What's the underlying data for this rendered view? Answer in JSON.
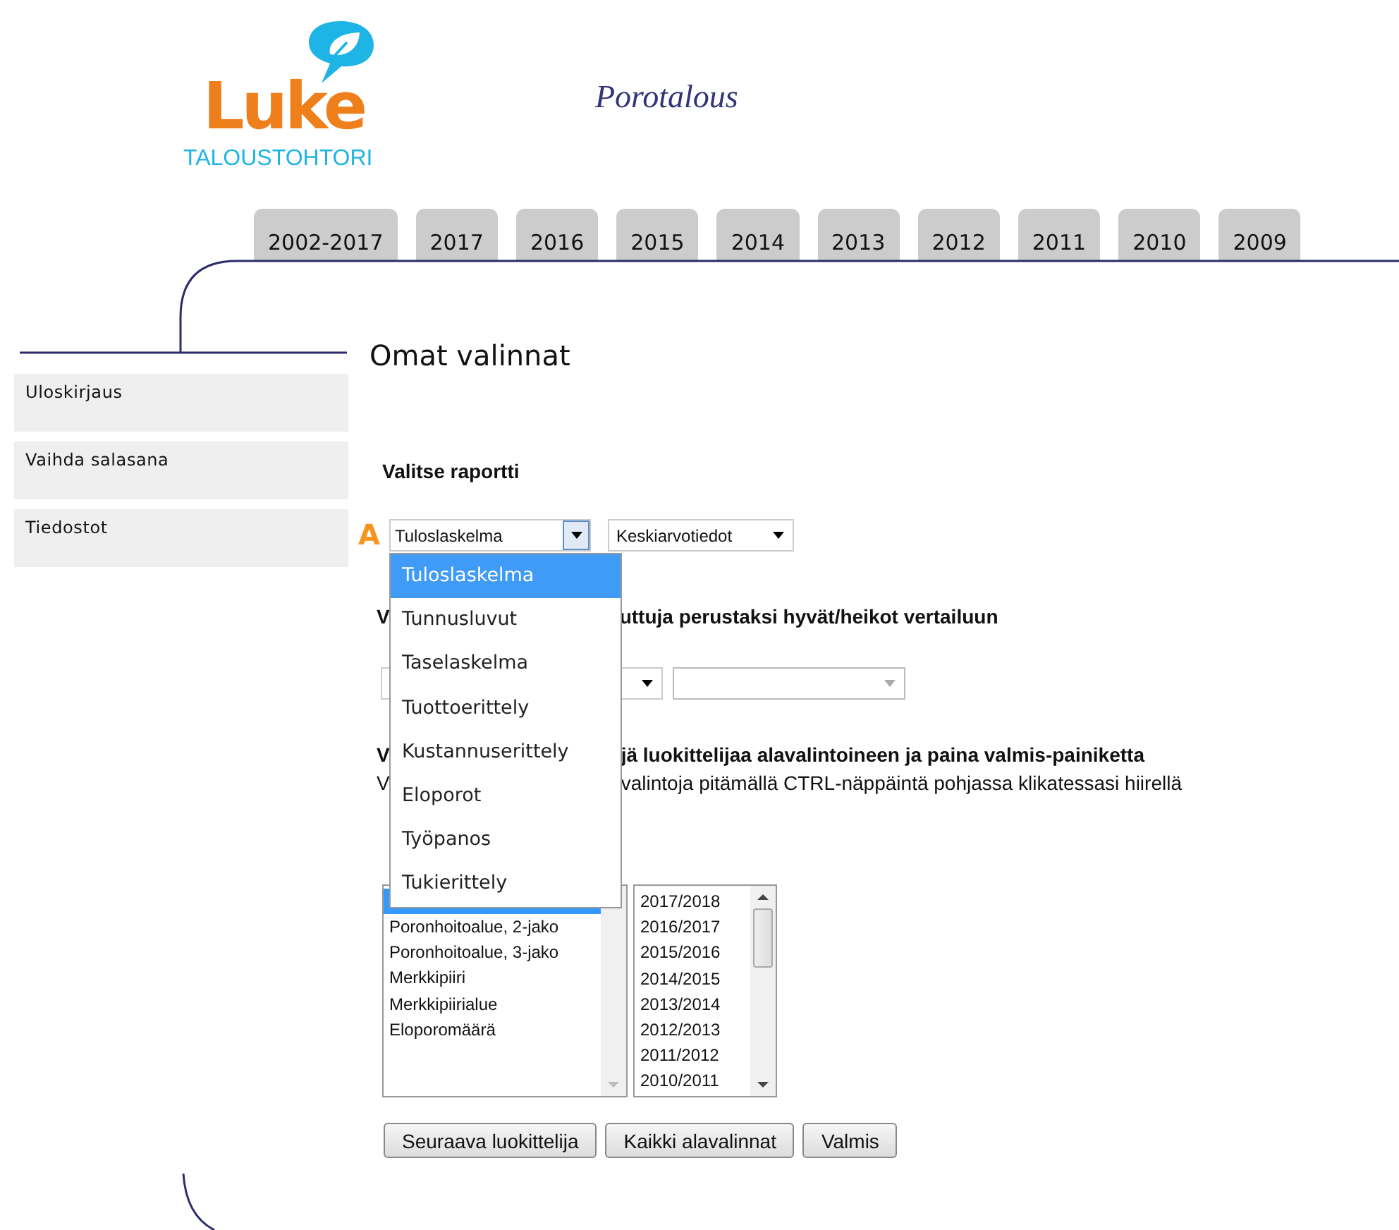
{
  "logo": {
    "wordmark": "Luke",
    "subtitle": "TALOUSTOHTORI"
  },
  "app_title": "Porotalous",
  "year_tabs": [
    {
      "label": "2002-2017",
      "selected": false
    },
    {
      "label": "2017",
      "selected": false
    },
    {
      "label": "2016",
      "selected": false
    },
    {
      "label": "2015",
      "selected": false
    },
    {
      "label": "2014",
      "selected": false
    },
    {
      "label": "2013",
      "selected": false
    },
    {
      "label": "2012",
      "selected": false
    },
    {
      "label": "2011",
      "selected": false
    },
    {
      "label": "2010",
      "selected": false
    },
    {
      "label": "2009",
      "selected": false
    }
  ],
  "sidebar": {
    "items": [
      "Uloskirjaus",
      "Vaihda salasana",
      "Tiedostot"
    ]
  },
  "page_title": "Omat valinnat",
  "report": {
    "label": "Valitse raportti",
    "marker": "A",
    "report_select": {
      "value": "Tuloslaskelma",
      "open": true
    },
    "data_select": {
      "value": "Keskiarvotiedot"
    },
    "options": [
      {
        "label": "Tuloslaskelma",
        "selected": true
      },
      {
        "label": "Tunnusluvut",
        "selected": false
      },
      {
        "label": "Taselaskelma",
        "selected": false
      },
      {
        "label": "Tuottoerittely",
        "selected": false
      },
      {
        "label": "Kustannuserittely",
        "selected": false
      },
      {
        "label": "Eloporot",
        "selected": false
      },
      {
        "label": "Työpanos",
        "selected": false
      },
      {
        "label": "Tukierittely",
        "selected": false
      }
    ]
  },
  "comparison": {
    "label_start": "V",
    "label_end": "uttuja perustaksi hyvät/heikot vertailuun",
    "second_select": {
      "disabled": true
    }
  },
  "classifier": {
    "instruction_start": "V",
    "instruction_end": "jä luokittelijaa alavalintoineen ja paina valmis-painiketta",
    "hint_start": "V",
    "hint_end": "valintoja pitämällä CTRL-näppäintä pohjassa klikatessasi hiirellä",
    "classifiers": [
      "Poronhoitoalue, 2-jako",
      "Poronhoitoalue, 3-jako",
      "Merkkipiiri",
      "Merkkipiirialue",
      "Eloporomäärä"
    ],
    "years": [
      "2017/2018",
      "2016/2017",
      "2015/2016",
      "2014/2015",
      "2013/2014",
      "2012/2013",
      "2011/2012",
      "2010/2011"
    ]
  },
  "buttons": [
    "Seuraava luokittelija",
    "Kaikki alavalinnat",
    "Valmis"
  ]
}
